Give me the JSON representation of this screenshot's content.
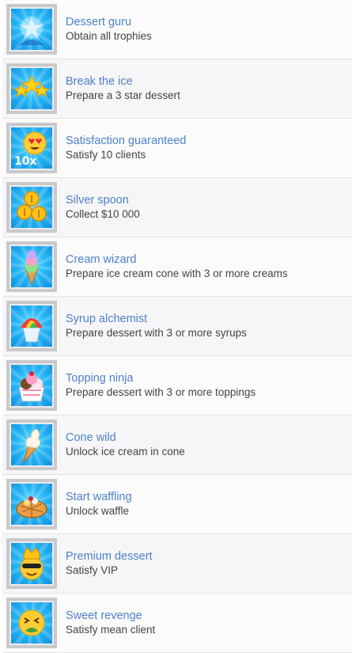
{
  "achievements": [
    {
      "icon": "trophy-star-icon",
      "title": "Dessert guru",
      "desc": "Obtain all trophies"
    },
    {
      "icon": "three-stars-icon",
      "title": "Break the ice",
      "desc": "Prepare a 3 star dessert"
    },
    {
      "icon": "heart-eyes-10x-icon",
      "title": "Satisfaction guaranteed",
      "desc": "Satisfy 10 clients",
      "badge": "10x"
    },
    {
      "icon": "gold-coins-icon",
      "title": "Silver spoon",
      "desc": "Collect $10 000"
    },
    {
      "icon": "ice-cream-cone-icon",
      "title": "Cream wizard",
      "desc": "Prepare ice cream cone with 3 or more creams"
    },
    {
      "icon": "snow-cone-icon",
      "title": "Syrup alchemist",
      "desc": "Prepare dessert with 3 or more syrups"
    },
    {
      "icon": "sundae-cup-icon",
      "title": "Topping ninja",
      "desc": "Prepare dessert with 3 or more toppings"
    },
    {
      "icon": "soft-serve-cone-icon",
      "title": "Cone wild",
      "desc": "Unlock ice cream in cone"
    },
    {
      "icon": "waffle-icon",
      "title": "Start waffling",
      "desc": "Unlock waffle"
    },
    {
      "icon": "vip-crown-emoji-icon",
      "title": "Premium dessert",
      "desc": "Satisfy VIP"
    },
    {
      "icon": "sick-emoji-icon",
      "title": "Sweet revenge",
      "desc": "Satisfy mean client"
    }
  ],
  "colors": {
    "title": "#4d81c8",
    "desc": "#444444",
    "tile": "#27b7f5",
    "thumb_border": "#c9c9cc"
  }
}
